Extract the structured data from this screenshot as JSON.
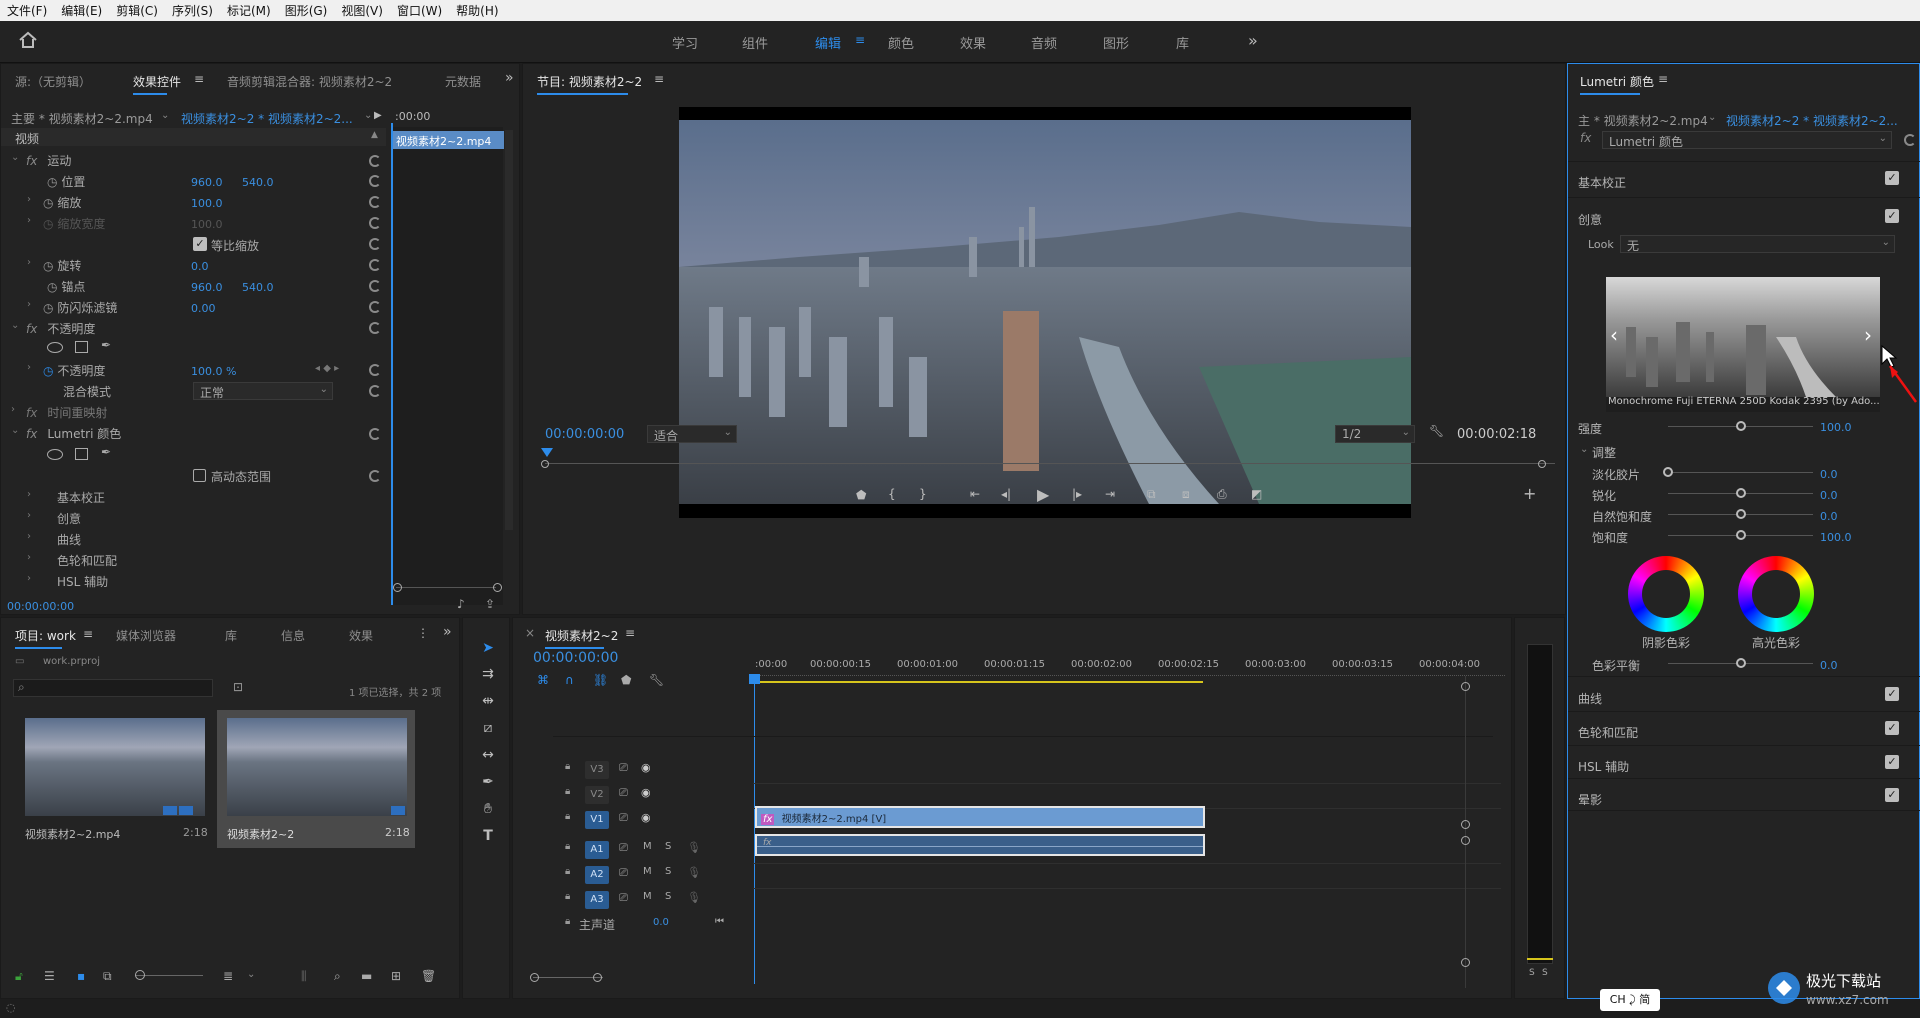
{
  "menu": [
    "文件(F)",
    "编辑(E)",
    "剪辑(C)",
    "序列(S)",
    "标记(M)",
    "图形(G)",
    "视图(V)",
    "窗口(W)",
    "帮助(H)"
  ],
  "workspaces": [
    "学习",
    "组件",
    "编辑",
    "颜色",
    "效果",
    "音频",
    "图形",
    "库"
  ],
  "active_workspace": "编辑",
  "source_panel": {
    "tabs": [
      "源:（无剪辑）",
      "效果控件",
      "音频剪辑混合器: 视频素材2~2",
      "元数据"
    ],
    "master_clip": "主要 * 视频素材2~2.mp4",
    "sequence_clip": "视频素材2~2 * 视频素材2~2...",
    "timecode_head": ":00:00",
    "clip_chip": "视频素材2~2.mp4",
    "section_video": "视频",
    "motion": "运动",
    "position_label": "位置",
    "position_x": "960.0",
    "position_y": "540.0",
    "scale_label": "缩放",
    "scale_value": "100.0",
    "scale_width_label": "缩放宽度",
    "scale_width_value": "100.0",
    "uniform_scale": "等比缩放",
    "rotation_label": "旋转",
    "rotation_value": "0.0",
    "anchor_label": "锚点",
    "anchor_x": "960.0",
    "anchor_y": "540.0",
    "antiflicker_label": "防闪烁滤镜",
    "antiflicker_value": "0.00",
    "opacity_section": "不透明度",
    "opacity_label": "不透明度",
    "opacity_value": "100.0 %",
    "blend_label": "混合模式",
    "blend_value": "正常",
    "time_remap": "时间重映射",
    "lumetri": "Lumetri 颜色",
    "hdr": "高动态范围",
    "sub_items": [
      "基本校正",
      "创意",
      "曲线",
      "色轮和匹配",
      "HSL 辅助"
    ],
    "timecode": "00:00:00:00"
  },
  "program_monitor": {
    "title": "节目: 视频素材2~2",
    "timecode": "00:00:00:00",
    "fit": "适合",
    "quality": "1/2",
    "duration": "00:00:02:18"
  },
  "project_panel": {
    "tabs": [
      "项目: work",
      "媒体浏览器",
      "库",
      "信息",
      "效果"
    ],
    "file": "work.prproj",
    "selection_info": "1 项已选择，共 2 项",
    "items": [
      {
        "name": "视频素材2~2.mp4",
        "duration": "2:18"
      },
      {
        "name": "视频素材2~2",
        "duration": "2:18"
      }
    ]
  },
  "timeline": {
    "title": "视频素材2~2",
    "timecode": "00:00:00:00",
    "ruler": [
      ":00:00",
      "00:00:00:15",
      "00:00:01:00",
      "00:00:01:15",
      "00:00:02:00",
      "00:00:02:15",
      "00:00:03:00",
      "00:00:03:15",
      "00:00:04:00"
    ],
    "video_tracks": [
      "V3",
      "V2",
      "V1"
    ],
    "audio_tracks": [
      "A1",
      "A2",
      "A3"
    ],
    "master_label": "主声道",
    "master_value": "0.0",
    "clip_label": "视频素材2~2.mp4 [V]",
    "m": "M",
    "s": "S"
  },
  "lumetri": {
    "title": "Lumetri 颜色",
    "master": "主 * 视频素材2~2.mp4",
    "sequence": "视频素材2~2 * 视频素材2~2...",
    "fx_name": "Lumetri 颜色",
    "basic": "基本校正",
    "creative": "创意",
    "look_label": "Look",
    "look_value": "无",
    "preview_caption": "Monochrome Fuji ETERNA 250D Kodak 2395 (by Ado...",
    "intensity_label": "强度",
    "intensity_value": "100.0",
    "intensity_level": 0.5,
    "adjust": "调整",
    "sliders": [
      {
        "label": "淡化胶片",
        "value": "0.0",
        "level": 0.0
      },
      {
        "label": "锐化",
        "value": "0.0",
        "level": 0.5
      },
      {
        "label": "自然饱和度",
        "value": "0.0",
        "level": 0.5
      },
      {
        "label": "饱和度",
        "value": "100.0",
        "level": 0.5
      }
    ],
    "shadow_tint": "阴影色彩",
    "highlight_tint": "高光色彩",
    "balance_label": "色彩平衡",
    "balance_value": "0.0",
    "balance_level": 0.5,
    "sections": [
      "曲线",
      "色轮和匹配",
      "HSL 辅助",
      "晕影"
    ]
  },
  "ime": "CH ⤸ 简",
  "meter_labels": [
    "S",
    "S"
  ],
  "colors": {
    "accent": "#2d8ceb",
    "clip_video": "#6b9bd2",
    "clip_audio": "#3a5f8a",
    "track_active": "#2a5c93"
  }
}
